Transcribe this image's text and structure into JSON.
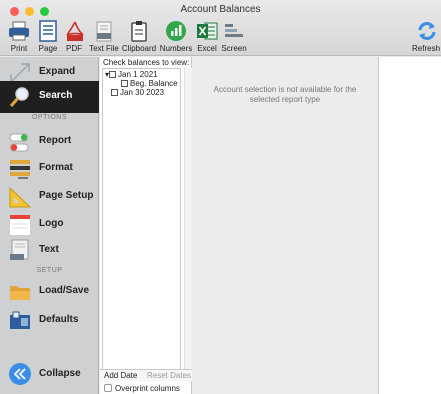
{
  "window": {
    "title": "Account Balances"
  },
  "toolbar": {
    "print": "Print",
    "page": "Page",
    "pdf": "PDF",
    "textfile": "Text File",
    "clipboard": "Clipboard",
    "numbers": "Numbers",
    "excel": "Excel",
    "screen": "Screen",
    "refresh": "Refresh"
  },
  "sidebar": {
    "expand": "Expand",
    "search": "Search",
    "options_header": "OPTIONS",
    "report": "Report",
    "format": "Format",
    "page_setup": "Page Setup",
    "logo": "Logo",
    "text": "Text",
    "setup_header": "SETUP",
    "load_save": "Load/Save",
    "defaults": "Defaults",
    "collapse": "Collapse"
  },
  "tree": {
    "header": "Check balances to view:",
    "items": [
      "Jan 1 2021",
      "Beg. Balance",
      "Jan 30 2023"
    ],
    "add_date": "Add Date",
    "reset_dates": "Reset Dates",
    "overprint": "Overprint columns"
  },
  "main": {
    "message_line1": "Account selection is not available for the",
    "message_line2": "selected report type"
  },
  "colors": {
    "active_item": "#1f1f1f",
    "sidebar_bg": "#cfd0d2",
    "accent_blue": "#3a8ee6",
    "numbers_green": "#2fa84a",
    "excel_green": "#1d7a3e",
    "pdf_red": "#c9322b"
  }
}
